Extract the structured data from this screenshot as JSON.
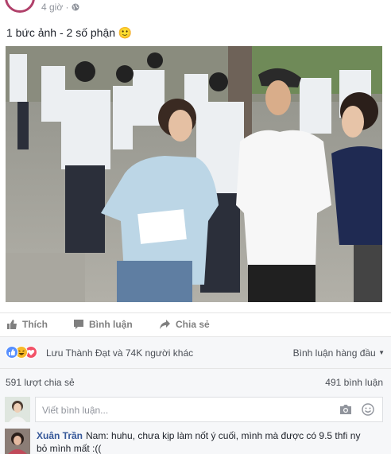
{
  "post": {
    "time": "4 giờ · ",
    "caption": "1 bức ảnh - 2 số phận ",
    "emoji": "🙂"
  },
  "actions": {
    "like_label": "Thích",
    "comment_label": "Bình luận",
    "share_label": "Chia sẻ"
  },
  "reactions": {
    "text": "Lưu Thành Đạt và 74K người khác",
    "icons": [
      "like-icon",
      "haha-icon",
      "love-icon"
    ],
    "sort_label": "Bình luận hàng đầu"
  },
  "counts": {
    "shares": "591 lượt chia sẻ",
    "comments": "491 bình luận"
  },
  "composer": {
    "placeholder": "Viết bình luận..."
  },
  "comment": {
    "author": "Xuân Trần",
    "text": "Nam: huhu, chưa kịp làm nốt ý cuối, mình mà được có 9.5 thfi ny bỏ mình mất :(("
  },
  "colors": {
    "link": "#365899",
    "like_blue": "#5890ff",
    "haha_yellow": "#f7b928",
    "love_red": "#f25268",
    "avatar_ring": "#b0406a"
  }
}
